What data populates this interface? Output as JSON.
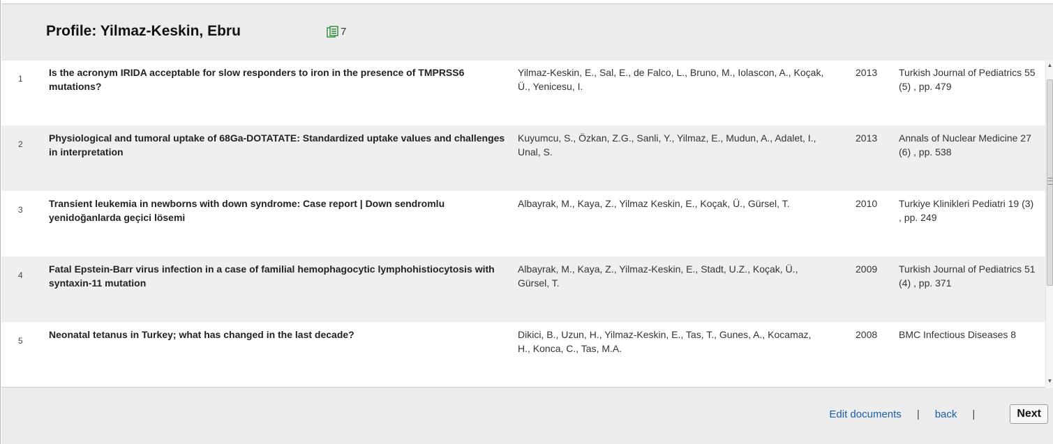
{
  "header": {
    "title": "Profile: Yilmaz-Keskin, Ebru",
    "doc_count": "7",
    "doc_icon": "documents-icon"
  },
  "documents": [
    {
      "index": "1",
      "title": "Is the acronym IRIDA acceptable for slow responders to iron in the presence of TMPRSS6 mutations?",
      "authors": "Yilmaz-Keskin, E., Sal, E., de Falco, L., Bruno, M., Iolascon, A., Koçak, Ü., Yenicesu, I.",
      "year": "2013",
      "source": "Turkish Journal of Pediatrics 55 (5) , pp. 479"
    },
    {
      "index": "2",
      "title": "Physiological and tumoral uptake of 68Ga-DOTATATE: Standardized uptake values and challenges in interpretation",
      "authors": "Kuyumcu, S., Özkan, Z.G., Sanli, Y., Yilmaz, E., Mudun, A., Adalet, I., Unal, S.",
      "year": "2013",
      "source": "Annals of Nuclear Medicine 27 (6) , pp. 538"
    },
    {
      "index": "3",
      "title": "Transient leukemia in newborns with down syndrome: Case report | Down sendromlu yenidoğanlarda geçici lösemi",
      "authors": "Albayrak, M., Kaya, Z., Yilmaz Keskin, E., Koçak, Ü., Gürsel, T.",
      "year": "2010",
      "source": "Turkiye Klinikleri Pediatri 19 (3) , pp. 249"
    },
    {
      "index": "4",
      "title": "Fatal Epstein-Barr virus infection in a case of familial hemophagocytic lymphohistiocytosis with syntaxin-11 mutation",
      "authors": "Albayrak, M., Kaya, Z., Yilmaz-Keskin, E., Stadt, U.Z., Koçak, Ü., Gürsel, T.",
      "year": "2009",
      "source": "Turkish Journal of Pediatrics 51 (4) , pp. 371"
    },
    {
      "index": "5",
      "title": "Neonatal tetanus in Turkey; what has changed in the last decade?",
      "authors": "Dikici, B., Uzun, H., Yilmaz-Keskin, E., Tas, T., Gunes, A., Kocamaz, H., Konca, C., Tas, M.A.",
      "year": "2008",
      "source": "BMC Infectious Diseases 8"
    }
  ],
  "footer": {
    "edit_label": "Edit documents",
    "separator": "|",
    "back_label": "back",
    "next_label": "Next"
  },
  "colors": {
    "header_bg": "#ececec",
    "row_alt_bg": "#efefef",
    "link": "#1a5ea8"
  }
}
